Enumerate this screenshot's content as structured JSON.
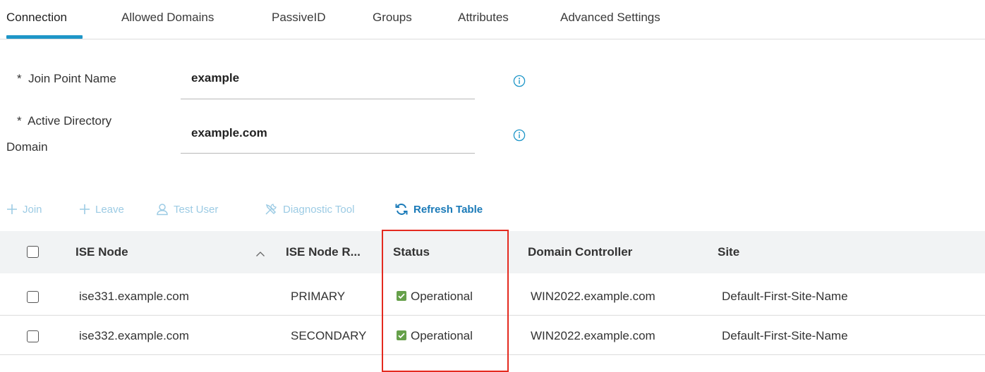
{
  "tabs": [
    {
      "label": "Connection",
      "active": true
    },
    {
      "label": "Allowed Domains"
    },
    {
      "label": "PassiveID"
    },
    {
      "label": "Groups"
    },
    {
      "label": "Attributes"
    },
    {
      "label": "Advanced Settings"
    }
  ],
  "form": {
    "join_point": {
      "required": "*",
      "label": "Join Point Name",
      "value": "example"
    },
    "ad_domain": {
      "required": "*",
      "label_line1": "Active Directory",
      "label_line2": "Domain",
      "value": "example.com"
    }
  },
  "toolbar": {
    "join": "Join",
    "leave": "Leave",
    "test_user": "Test User",
    "diagnostic_tool": "Diagnostic Tool",
    "refresh_table": "Refresh Table"
  },
  "table": {
    "columns": [
      "ISE Node",
      "ISE Node R...",
      "Status",
      "Domain Controller",
      "Site"
    ],
    "rows": [
      {
        "ise_node": "ise331.example.com",
        "role": "PRIMARY",
        "status": "Operational",
        "domain_controller": "WIN2022.example.com",
        "site": "Default-First-Site-Name"
      },
      {
        "ise_node": "ise332.example.com",
        "role": "SECONDARY",
        "status": "Operational",
        "domain_controller": "WIN2022.example.com",
        "site": "Default-First-Site-Name"
      }
    ]
  },
  "colors": {
    "accent": "#1e96c8",
    "link_disabled": "#9ccbe4",
    "link_active": "#1a7ab8",
    "status_ok": "#66a04a",
    "highlight": "#e42a1f"
  }
}
